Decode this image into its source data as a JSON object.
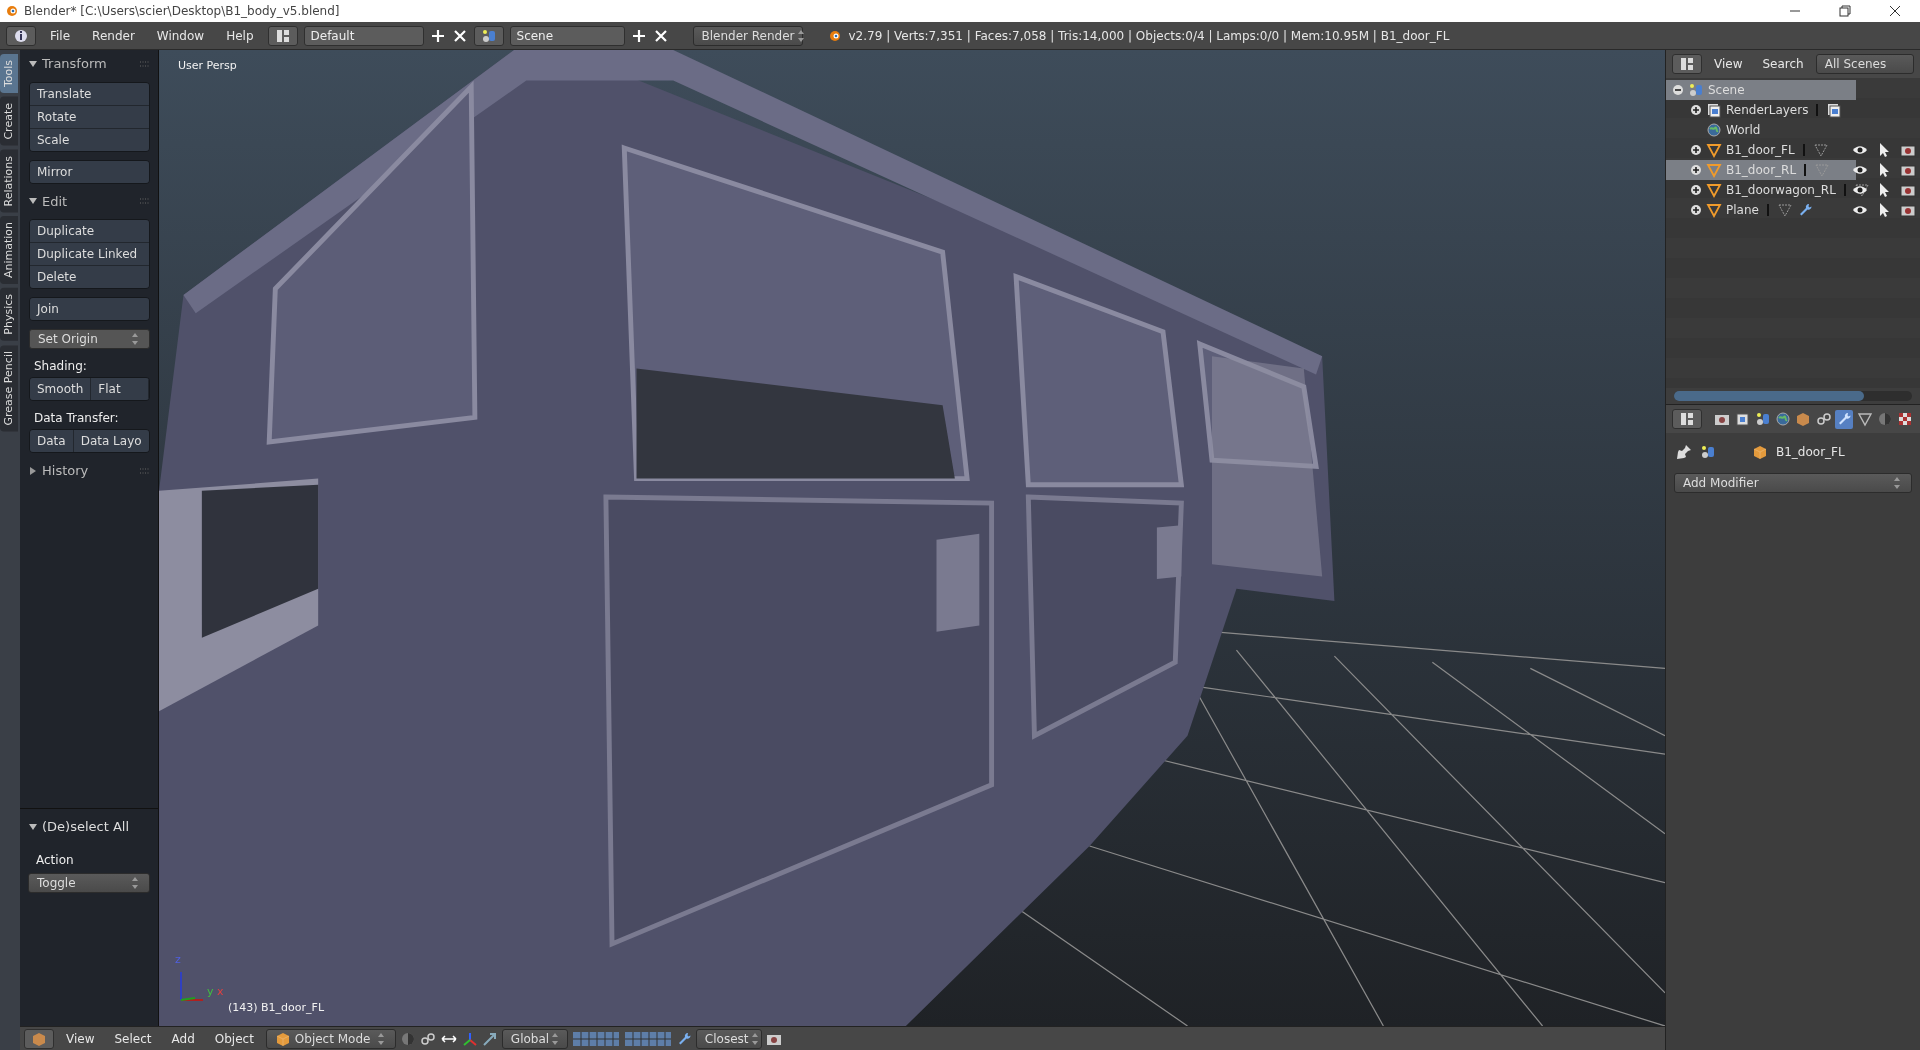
{
  "window": {
    "title": "Blender* [C:\\Users\\scier\\Desktop\\B1_body_v5.blend]"
  },
  "info_header": {
    "menus": [
      "File",
      "Render",
      "Window",
      "Help"
    ],
    "layout": "Default",
    "scene": "Scene",
    "engine": "Blender Render",
    "stats": "v2.79 | Verts:7,351 | Faces:7,058 | Tris:14,000 | Objects:0/4 | Lamps:0/0 | Mem:10.95M | B1_door_FL"
  },
  "tool_shelf": {
    "tabs": [
      {
        "label": "Tools",
        "selected": true
      },
      {
        "label": "Create",
        "selected": false
      },
      {
        "label": "Relations",
        "selected": false
      },
      {
        "label": "Animation",
        "selected": false
      },
      {
        "label": "Physics",
        "selected": false
      },
      {
        "label": "Grease Pencil",
        "selected": false
      }
    ],
    "panels": [
      {
        "title": "Transform",
        "expanded": true,
        "items": [
          {
            "kind": "stack",
            "buttons": [
              "Translate",
              "Rotate",
              "Scale"
            ]
          },
          {
            "kind": "stack",
            "buttons": [
              "Mirror"
            ]
          }
        ]
      },
      {
        "title": "Edit",
        "expanded": true,
        "items": [
          {
            "kind": "stack",
            "buttons": [
              "Duplicate",
              "Duplicate Linked",
              "Delete"
            ]
          },
          {
            "kind": "stack",
            "buttons": [
              "Join"
            ]
          },
          {
            "kind": "dropdown",
            "value": "Set Origin"
          },
          {
            "kind": "label",
            "text": "Shading:"
          },
          {
            "kind": "row",
            "buttons": [
              "Smooth",
              "Flat"
            ]
          },
          {
            "kind": "label",
            "text": "Data Transfer:"
          },
          {
            "kind": "row",
            "buttons": [
              "Data",
              "Data Layo"
            ]
          }
        ]
      },
      {
        "title": "History",
        "expanded": false
      }
    ]
  },
  "operator_panel": {
    "title": "(De)select All",
    "expanded": true,
    "label": "Action",
    "value": "Toggle"
  },
  "viewport": {
    "view_label": "User Persp",
    "object_label": "(143) B1_door_FL",
    "axes": [
      "z",
      "y",
      "x"
    ]
  },
  "outliner": {
    "menus": [
      "View",
      "Search"
    ],
    "filter": "All Scenes",
    "tree": [
      {
        "name": "Scene",
        "kind": "scene",
        "expanded": true,
        "selected": true,
        "children": [
          {
            "name": "RenderLayers",
            "kind": "renderlayers",
            "expanded": false,
            "selected": false
          },
          {
            "name": "World",
            "kind": "world",
            "selected": false
          },
          {
            "name": "B1_door_FL",
            "kind": "mesh",
            "expanded": false,
            "selected": false,
            "modifier": false
          },
          {
            "name": "B1_door_RL",
            "kind": "mesh",
            "expanded": false,
            "selected": true,
            "modifier": false
          },
          {
            "name": "B1_doorwagon_RL",
            "kind": "mesh",
            "expanded": false,
            "selected": false,
            "modifier": false
          },
          {
            "name": "Plane",
            "kind": "mesh",
            "expanded": false,
            "selected": false,
            "modifier": true
          }
        ]
      }
    ]
  },
  "properties": {
    "tabs": [
      {
        "kind": "render",
        "selected": false
      },
      {
        "kind": "render_layers",
        "selected": false
      },
      {
        "kind": "scene",
        "selected": false
      },
      {
        "kind": "world",
        "selected": false
      },
      {
        "kind": "object",
        "selected": false
      },
      {
        "kind": "constraints",
        "selected": false
      },
      {
        "kind": "modifiers",
        "selected": true
      },
      {
        "kind": "data",
        "selected": false
      },
      {
        "kind": "material",
        "selected": false
      },
      {
        "kind": "texture",
        "selected": false
      }
    ],
    "object": "B1_door_FL",
    "add_button": "Add Modifier"
  },
  "bottom_header": {
    "menus": [
      "View",
      "Select",
      "Add",
      "Object"
    ],
    "mode": "Object Mode",
    "orientation": "Global",
    "snap": "Closest"
  }
}
